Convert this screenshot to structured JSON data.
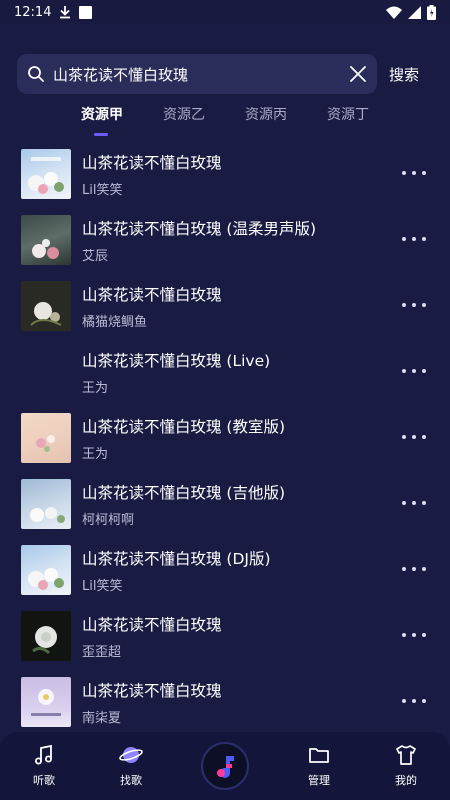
{
  "status_bar": {
    "time": "12:14"
  },
  "search": {
    "value": "山茶花读不懂白玫瑰",
    "button_label": "搜索"
  },
  "tabs": [
    {
      "label": "资源甲",
      "active": true
    },
    {
      "label": "资源乙",
      "active": false
    },
    {
      "label": "资源丙",
      "active": false
    },
    {
      "label": "资源丁",
      "active": false
    }
  ],
  "results": [
    {
      "title": "山茶花读不懂白玫瑰",
      "artist": "Lil笑笑"
    },
    {
      "title": "山茶花读不懂白玫瑰 (温柔男声版)",
      "artist": "艾辰"
    },
    {
      "title": "山茶花读不懂白玫瑰",
      "artist": "橘猫烧鲷鱼"
    },
    {
      "title": "山茶花读不懂白玫瑰 (Live)",
      "artist": "王为"
    },
    {
      "title": "山茶花读不懂白玫瑰 (教室版)",
      "artist": "王为"
    },
    {
      "title": "山茶花读不懂白玫瑰 (吉他版)",
      "artist": "柯柯柯啊"
    },
    {
      "title": "山茶花读不懂白玫瑰 (DJ版)",
      "artist": "Lil笑笑"
    },
    {
      "title": "山茶花读不懂白玫瑰",
      "artist": "歪歪超"
    },
    {
      "title": "山茶花读不懂白玫瑰",
      "artist": "南柒夏"
    }
  ],
  "bottom_nav": [
    {
      "label": "听歌",
      "icon": "music-note-icon"
    },
    {
      "label": "找歌",
      "icon": "planet-icon"
    },
    {
      "label": "管理",
      "icon": "folder-icon"
    },
    {
      "label": "我的",
      "icon": "shirt-icon"
    }
  ],
  "colors": {
    "background": "#1a1b43",
    "accent": "#6c5cff",
    "nav": "#13153a"
  }
}
